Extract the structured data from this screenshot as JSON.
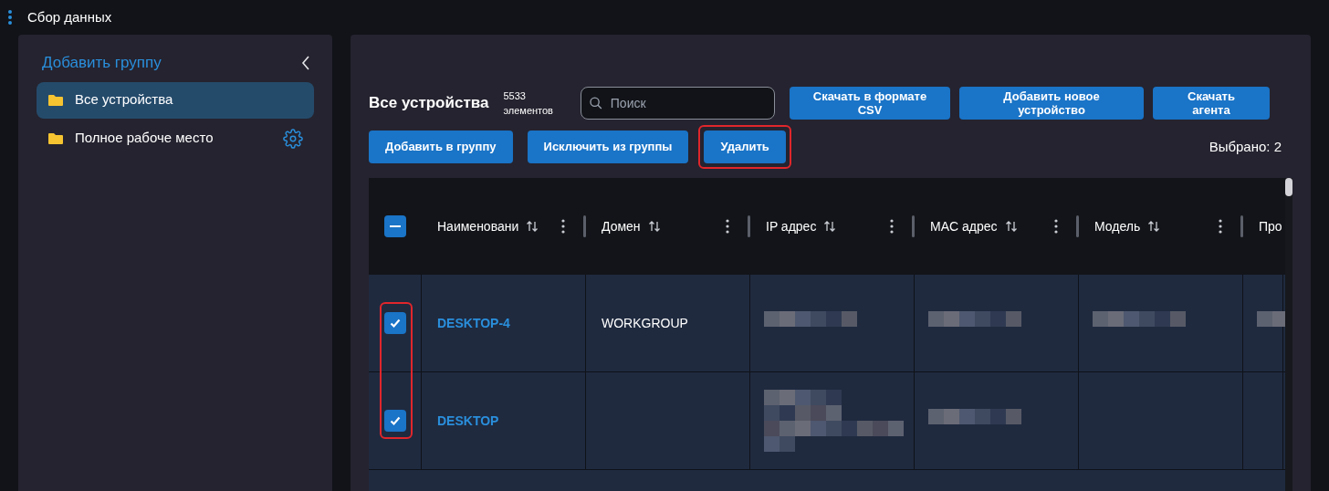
{
  "app_bar": {
    "title": "Сбор данных"
  },
  "sidebar": {
    "add_group_label": "Добавить группу",
    "groups": [
      {
        "label": "Все устройства",
        "selected": true,
        "has_settings": false
      },
      {
        "label": "Полное рабоче место",
        "selected": false,
        "has_settings": true
      }
    ]
  },
  "main": {
    "title": "Все устройства",
    "count": "5533",
    "count_unit": "элементов",
    "search": {
      "placeholder": "Поиск"
    },
    "top_buttons": [
      {
        "label": "Скачать в формате CSV"
      },
      {
        "label": "Добавить новое устройство"
      },
      {
        "label": "Скачать агента"
      }
    ],
    "action_buttons": [
      {
        "label": "Добавить в группу",
        "highlighted": false
      },
      {
        "label": "Исключить из группы",
        "highlighted": false
      },
      {
        "label": "Удалить",
        "highlighted": true
      }
    ],
    "selected_count": "Выбрано: 2"
  },
  "table": {
    "header_checked": true,
    "header_indeterminate": true,
    "checkboxes_highlighted": true,
    "columns": [
      {
        "label": "Наименовани"
      },
      {
        "label": "Домен"
      },
      {
        "label": "IP адрес"
      },
      {
        "label": "MAC адрес"
      },
      {
        "label": "Модель"
      },
      {
        "label": "Про"
      }
    ],
    "rows": [
      {
        "checked": true,
        "cells": [
          {
            "kind": "link",
            "text": "DESKTOP-4"
          },
          {
            "kind": "text",
            "text": "WORKGROUP"
          },
          {
            "kind": "redacted"
          },
          {
            "kind": "redacted"
          },
          {
            "kind": "redacted"
          },
          {
            "kind": "redacted"
          }
        ]
      },
      {
        "checked": true,
        "cells": [
          {
            "kind": "link",
            "text": "DESKTOP"
          },
          {
            "kind": "empty"
          },
          {
            "kind": "redacted_tall"
          },
          {
            "kind": "redacted"
          },
          {
            "kind": "empty"
          },
          {
            "kind": "empty"
          }
        ]
      }
    ]
  }
}
